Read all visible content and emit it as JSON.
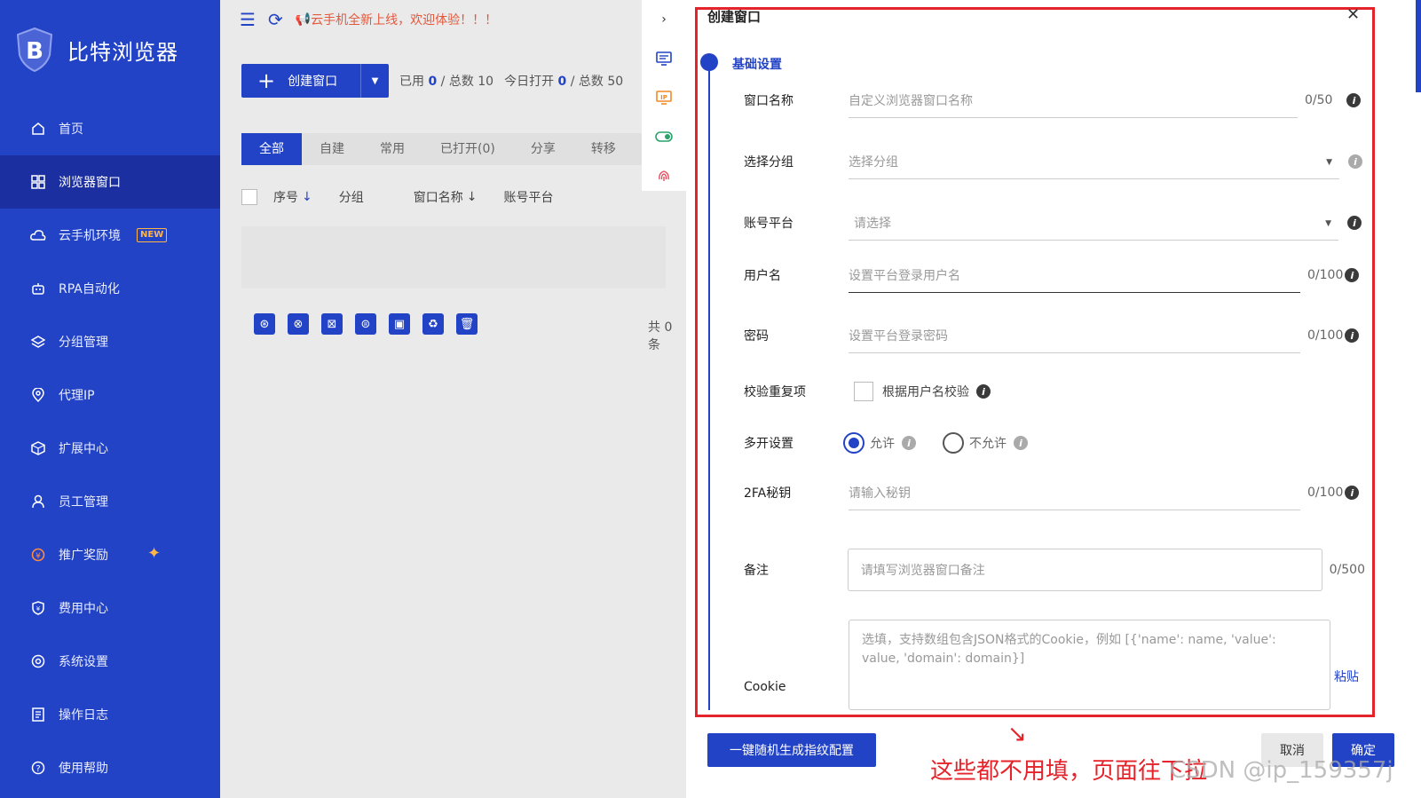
{
  "app": {
    "logo_text": "比特浏览器"
  },
  "sidebar": {
    "items": [
      {
        "label": "首页",
        "icon": "home-icon"
      },
      {
        "label": "浏览器窗口",
        "icon": "grid-icon",
        "active": true
      },
      {
        "label": "云手机环境",
        "icon": "cloud-icon",
        "badge": "NEW"
      },
      {
        "label": "RPA自动化",
        "icon": "robot-icon"
      },
      {
        "label": "分组管理",
        "icon": "layers-icon"
      },
      {
        "label": "代理IP",
        "icon": "location-icon"
      },
      {
        "label": "扩展中心",
        "icon": "cube-icon"
      },
      {
        "label": "员工管理",
        "icon": "person-icon"
      },
      {
        "label": "推广奖励",
        "icon": "reward-icon"
      },
      {
        "label": "费用中心",
        "icon": "shield-yen-icon"
      },
      {
        "label": "系统设置",
        "icon": "gear-icon"
      },
      {
        "label": "操作日志",
        "icon": "log-icon"
      },
      {
        "label": "使用帮助",
        "icon": "help-icon"
      }
    ]
  },
  "topbar": {
    "notice": "云手机全新上线，欢迎体验！！！"
  },
  "toolbar": {
    "create_label": "创建窗口",
    "used_label": "已用",
    "used_value": "0",
    "total_label": "/ 总数 10",
    "opened_label": "今日打开",
    "opened_value": "0",
    "opened_total": "/ 总数 50"
  },
  "tabs": [
    "全部",
    "自建",
    "常用",
    "已打开(0)",
    "分享",
    "转移"
  ],
  "table": {
    "headers": [
      "序号",
      "分组",
      "窗口名称",
      "账号平台"
    ],
    "total": "共 0 条"
  },
  "drawer": {
    "title": "创建窗口",
    "section": "基础设置",
    "fields": {
      "name": {
        "label": "窗口名称",
        "placeholder": "自定义浏览器窗口名称",
        "count": "0/50"
      },
      "group": {
        "label": "选择分组",
        "placeholder": "选择分组"
      },
      "platform": {
        "label": "账号平台",
        "placeholder": "请选择"
      },
      "username": {
        "label": "用户名",
        "placeholder": "设置平台登录用户名",
        "count": "0/100"
      },
      "password": {
        "label": "密码",
        "placeholder": "设置平台登录密码",
        "count": "0/100"
      },
      "dedupe": {
        "label": "校验重复项",
        "option": "根据用户名校验"
      },
      "multi": {
        "label": "多开设置",
        "allow": "允许",
        "deny": "不允许"
      },
      "twofa": {
        "label": "2FA秘钥",
        "placeholder": "请输入秘钥",
        "count": "0/100"
      },
      "remark": {
        "label": "备注",
        "placeholder": "请填写浏览器窗口备注",
        "count": "0/500"
      },
      "cookie": {
        "label": "Cookie",
        "placeholder": "选填，支持数组包含JSON格式的Cookie，例如 [{'name': name, 'value': value, 'domain': domain}]",
        "paste": "粘贴"
      }
    },
    "footer": {
      "generate": "一键随机生成指纹配置",
      "cancel": "取消",
      "ok": "确定"
    }
  },
  "annotation": {
    "text": "这些都不用填，页面往下拉"
  },
  "watermark": "CSDN @ip_159357j",
  "colors": {
    "brand": "#2343c7",
    "sidebar_active": "#1b2fa0",
    "annotation": "#e5232a",
    "notice": "#e4583c"
  }
}
